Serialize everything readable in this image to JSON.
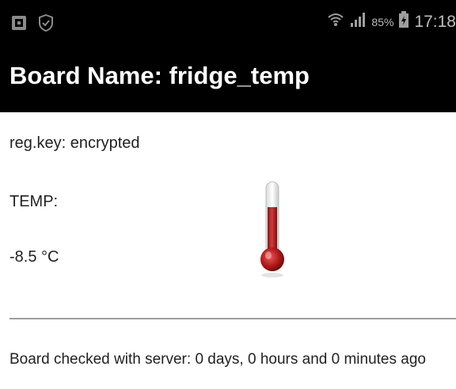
{
  "status_bar": {
    "left_icons": [
      "notification-square-icon",
      "shield-check-icon"
    ],
    "battery_percent": "85%",
    "time": "17:18",
    "right_icons": [
      "wifi-icon",
      "signal-icon",
      "battery-icon"
    ]
  },
  "app_bar": {
    "title": "Board Name: fridge_temp"
  },
  "content": {
    "reg_key": "reg.key: encrypted",
    "temp_label": "TEMP:",
    "temp_value": "-8.5 °C",
    "thermometer_icon": "thermometer-icon",
    "last_checked": "Board checked with server: 0 days, 0 hours and 0 minutes ago"
  },
  "colors": {
    "statusbar_bg": "#000000",
    "appbar_bg": "#000000",
    "title_text": "#ffffff",
    "thermometer_red": "#b71c1c"
  }
}
